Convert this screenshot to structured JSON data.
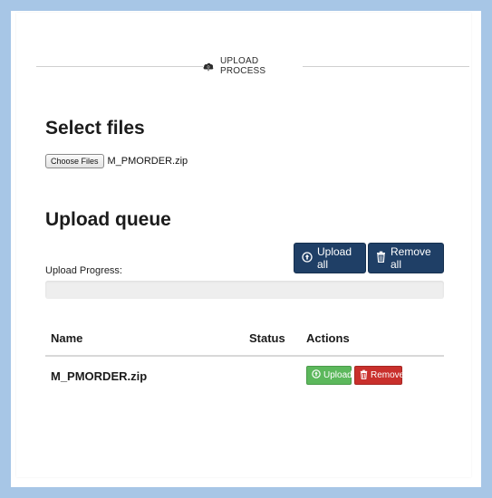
{
  "header": {
    "title": "UPLOAD PROCESS",
    "icon": "cloud-upload-icon"
  },
  "select_files": {
    "heading": "Select files",
    "choose_button": "Choose Files",
    "chosen_file": "M_PMORDER.zip"
  },
  "queue": {
    "heading": "Upload queue",
    "upload_all_label": "Upload all",
    "remove_all_label": "Remove all",
    "progress_label": "Upload Progress:",
    "progress_value": 0
  },
  "table": {
    "columns": [
      "Name",
      "Status",
      "Actions"
    ],
    "rows": [
      {
        "name": "M_PMORDER.zip",
        "status": "",
        "upload_label": "Upload",
        "remove_label": "Remove"
      }
    ]
  },
  "colors": {
    "frame": "#a7c6e6",
    "primary": "#1f3f66",
    "success": "#5cb85c",
    "danger": "#c9302c"
  }
}
